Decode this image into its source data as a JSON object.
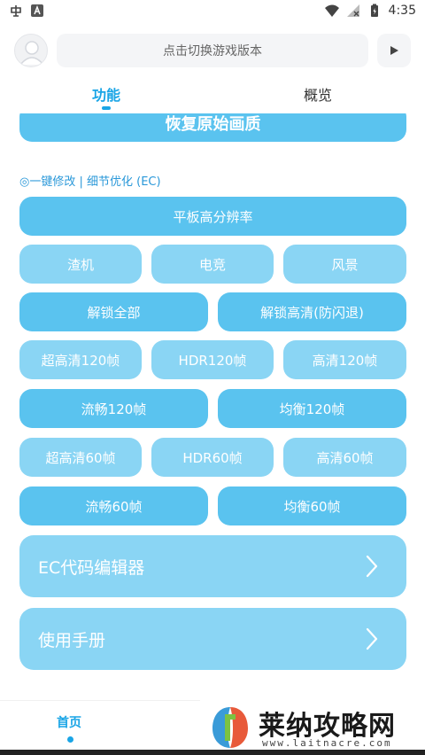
{
  "status_bar": {
    "time": "4:35"
  },
  "header": {
    "search_placeholder": "点击切换游戏版本"
  },
  "tabs": [
    {
      "label": "功能"
    },
    {
      "label": "概览"
    }
  ],
  "content": {
    "restore_label": "恢复原始画质",
    "section_label": "◎一键修改 | 细节优化 (EC)",
    "buttons": {
      "tablet_hd": "平板高分辨率",
      "scum": "渣机",
      "esports": "电竞",
      "scenery": "风景",
      "unlock_all": "解锁全部",
      "unlock_hd": "解锁高清(防闪退)",
      "ultra_hd_120": "超高清120帧",
      "hdr_120": "HDR120帧",
      "hd_120": "高清120帧",
      "smooth_120": "流畅120帧",
      "balanced_120": "均衡120帧",
      "ultra_hd_60": "超高清60帧",
      "hdr_60": "HDR60帧",
      "hd_60": "高清60帧",
      "smooth_60": "流畅60帧",
      "balanced_60": "均衡60帧"
    },
    "rows": {
      "ec_editor": "EC代码编辑器",
      "manual": "使用手册"
    }
  },
  "bottom_nav": {
    "home": "首页"
  },
  "watermark": {
    "title": "莱纳攻略网",
    "url": "www.laitnacre.com"
  },
  "colors": {
    "accent": "#1aa5e6",
    "button_strong": "#5ac3ef",
    "button_light": "#8ad5f4"
  }
}
